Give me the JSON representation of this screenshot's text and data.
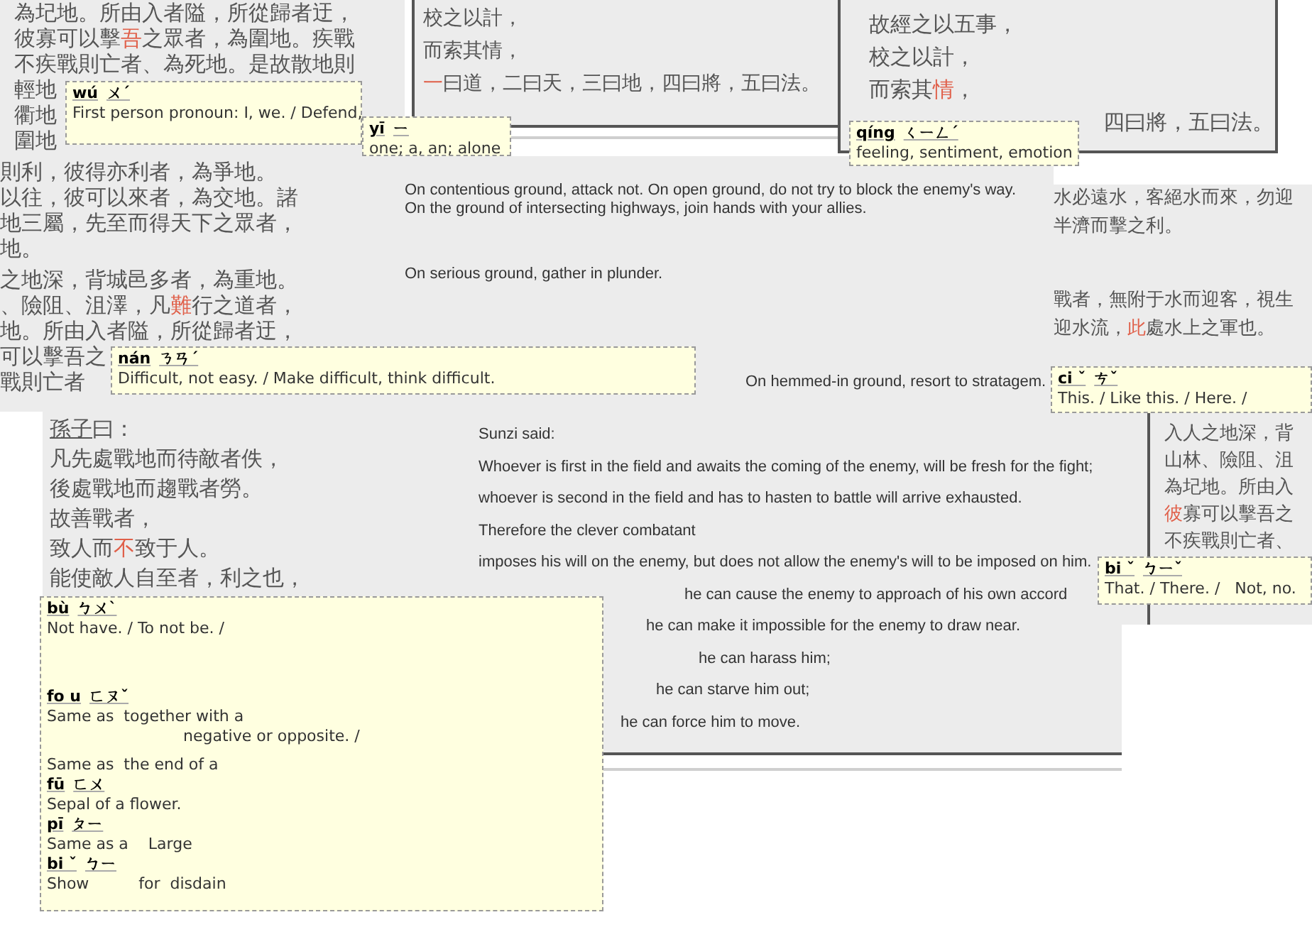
{
  "panels": [
    {
      "kind": "chinese",
      "lines": [
        [
          {
            "text": "為圮地。所由入者隘，所從歸者迂，",
            "highlighted": false
          }
        ],
        [
          {
            "text": "彼寡可以擊",
            "highlighted": false
          },
          {
            "text": "吾",
            "highlighted": true
          },
          {
            "text": "之眾者，為圍地。疾戰",
            "highlighted": false
          }
        ],
        [
          {
            "text": "不疾戰則亡者、為死地。是故散地則",
            "highlighted": false
          }
        ],
        [
          {
            "text": "輕地",
            "highlighted": false
          }
        ],
        [
          {
            "text": "衢地",
            "highlighted": false
          }
        ],
        [
          {
            "text": "圍地",
            "highlighted": false
          }
        ]
      ]
    },
    {
      "kind": "popup",
      "entries": [
        {
          "pinyin": "wú",
          "zhuyin": "ㄨˊ",
          "definitions": [
            "First person pronoun: I, we. / Defend,"
          ]
        }
      ]
    },
    {
      "kind": "popup",
      "entries": [
        {
          "pinyin": "yī",
          "zhuyin": "ㄧ",
          "definitions": [
            "one; a, an; alone"
          ]
        }
      ]
    },
    {
      "kind": "chinese",
      "lines": [
        [
          {
            "text": "校之以計，",
            "highlighted": false
          }
        ],
        [
          {
            "text": "而索其情，",
            "highlighted": false
          }
        ],
        [
          {
            "text": "一",
            "highlighted": true
          },
          {
            "text": "曰道，二曰天，三曰地，四曰將，五曰法。",
            "highlighted": false
          }
        ]
      ]
    },
    {
      "kind": "chinese",
      "lines": [
        [
          {
            "text": "故經之以五事，",
            "highlighted": false
          }
        ],
        [
          {
            "text": "校之以計，",
            "highlighted": false
          }
        ],
        [
          {
            "text": "而索其",
            "highlighted": false
          },
          {
            "text": "情",
            "highlighted": true
          },
          {
            "text": "，",
            "highlighted": false
          }
        ],
        [
          {
            "text": "四曰將，五曰法。",
            "highlighted": false
          }
        ]
      ]
    },
    {
      "kind": "popup",
      "entries": [
        {
          "pinyin": "qíng",
          "zhuyin": "ㄑㄧㄥˊ",
          "definitions": [
            "feeling, sentiment, emotion"
          ]
        }
      ]
    },
    {
      "kind": "chinese",
      "lines": [
        [
          {
            "text": "則利，彼得亦利者，為爭地。",
            "highlighted": false
          }
        ],
        [
          {
            "text": "以往，彼可以來者，為交地。諸",
            "highlighted": false
          }
        ],
        [
          {
            "text": "地三屬，先至而得天下之眾者，",
            "highlighted": false
          }
        ],
        [
          {
            "text": "地。",
            "highlighted": false
          }
        ],
        [
          {
            "text": "之地深，背城邑多者，為重地。",
            "highlighted": false
          }
        ],
        [
          {
            "text": "、險阻、沮澤，凡",
            "highlighted": false
          },
          {
            "text": "難",
            "highlighted": true
          },
          {
            "text": "行之道者，",
            "highlighted": false
          }
        ],
        [
          {
            "text": "地。所由入者隘，所從歸者迂，",
            "highlighted": false
          }
        ],
        [
          {
            "text": "可以擊吾之",
            "highlighted": false
          }
        ],
        [
          {
            "text": "戰則亡者",
            "highlighted": false
          }
        ]
      ]
    },
    {
      "kind": "popup",
      "entries": [
        {
          "pinyin": "nán",
          "zhuyin": "ㄋㄢˊ",
          "definitions": [
            "Difficult, not easy. / Make difficult, think difficult."
          ]
        }
      ]
    },
    {
      "kind": "english",
      "lines": [
        "On contentious ground, attack not. On open ground, do not try to block the enemy's way.",
        "On the ground of intersecting highways, join hands with your allies.",
        "On serious ground, gather in plunder.",
        "On hemmed-in ground, resort to stratagem."
      ]
    },
    {
      "kind": "chinese",
      "lines": [
        [
          {
            "text": "水必遠水，客絕水而來，勿迎",
            "highlighted": false
          }
        ],
        [
          {
            "text": "半濟而擊之利。",
            "highlighted": false
          }
        ],
        [
          {
            "text": "戰者，無附于水而迎客，視生",
            "highlighted": false
          }
        ],
        [
          {
            "text": "迎水流，",
            "highlighted": false
          },
          {
            "text": "此",
            "highlighted": true
          },
          {
            "text": "處水上之軍也。",
            "highlighted": false
          }
        ]
      ]
    },
    {
      "kind": "popup",
      "entries": [
        {
          "pinyin": "ci ˇ",
          "zhuyin": "ㄘˇ",
          "definitions": [
            "This. / Like this. / Here. /"
          ]
        }
      ]
    },
    {
      "kind": "chinese",
      "lines": [
        [
          {
            "text": "孫子",
            "highlighted": false,
            "underlined": true
          },
          {
            "text": "曰：",
            "highlighted": false
          }
        ],
        [
          {
            "text": "凡先處戰地而待敵者佚，",
            "highlighted": false
          }
        ],
        [
          {
            "text": "後處戰地而趨戰者勞。",
            "highlighted": false
          }
        ],
        [
          {
            "text": "故善戰者，",
            "highlighted": false
          }
        ],
        [
          {
            "text": "致人而",
            "highlighted": false
          },
          {
            "text": "不",
            "highlighted": true
          },
          {
            "text": "致于人。",
            "highlighted": false
          }
        ],
        [
          {
            "text": "能使敵人自至者，利之也，",
            "highlighted": false
          }
        ]
      ]
    },
    {
      "kind": "english",
      "lines": [
        "Sunzi said:",
        "Whoever is first in the field and awaits the coming of the enemy, will be fresh for the fight;",
        "whoever is second in the field and has to hasten to battle will arrive exhausted.",
        "Therefore the clever combatant",
        "imposes his will on the enemy, but does not allow the enemy's will to be imposed on him.",
        "he can cause the enemy to approach of his own accord",
        "he can make it impossible for the enemy to draw near.",
        "he can harass him;",
        "he can starve him out;",
        "he can force him to move."
      ]
    },
    {
      "kind": "chinese",
      "lines": [
        [
          {
            "text": "入人之地深，背",
            "highlighted": false
          }
        ],
        [
          {
            "text": "山林、險阻、沮",
            "highlighted": false
          }
        ],
        [
          {
            "text": "為圮地。所由入",
            "highlighted": false
          }
        ],
        [
          {
            "text": "彼",
            "highlighted": true
          },
          {
            "text": "寡可以擊吾之",
            "highlighted": false
          }
        ],
        [
          {
            "text": "不疾戰則亡者、",
            "highlighted": false
          }
        ]
      ]
    },
    {
      "kind": "popup",
      "entries": [
        {
          "pinyin": "bi ˇ",
          "zhuyin": "ㄅㄧˇ",
          "definitions": [
            "That. / There. /   Not, no."
          ]
        }
      ]
    },
    {
      "kind": "popup",
      "entries": [
        {
          "pinyin": "bù",
          "zhuyin": "ㄅㄨˋ",
          "definitions": [
            "Not have. / To not be. /"
          ]
        },
        {
          "pinyin": "fo u",
          "zhuyin": "ㄈㄡˇ",
          "definitions": [
            "Same as  together with a",
            "negative or opposite. /"
          ]
        },
        {
          "definitions": [
            "Same as  the end of a"
          ]
        },
        {
          "pinyin": "fū",
          "zhuyin": "ㄈㄨ",
          "definitions": [
            "Sepal of a flower."
          ]
        },
        {
          "pinyin": "pī",
          "zhuyin": "ㄆㄧ",
          "definitions": [
            "Same as a    Large"
          ]
        },
        {
          "pinyin": "bi ˇ",
          "zhuyin": "ㄅㄧ",
          "definitions": [
            "Show          for  disdain"
          ]
        }
      ]
    }
  ]
}
